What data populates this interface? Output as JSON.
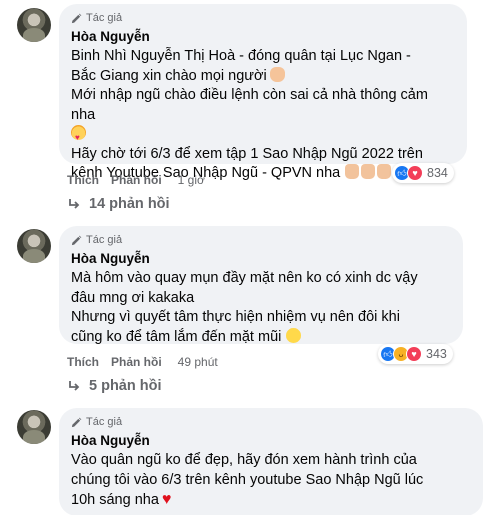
{
  "comments": [
    {
      "badge": "Tác giả",
      "author": "Hòa Nguyễn",
      "lines": [
        "Binh Nhì Nguyễn Thị Hoà - đóng quân tại Lục Ngan -",
        "Bắc Giang xin chào mọi người",
        "Mới nhập ngũ chào điều lệnh còn sai cả nhà thông cảm",
        "nha",
        "Hãy chờ tới 6/3 để xem tập 1 Sao Nhập Ngũ 2022 trên",
        "kênh Youtube Sao Nhập Ngũ - QPVN nha"
      ],
      "like_label": "Thích",
      "reply_label": "Phản hồi",
      "time": "1 giờ",
      "reaction_count": "834",
      "replies_label": "14 phản hồi"
    },
    {
      "badge": "Tác giả",
      "author": "Hòa Nguyễn",
      "lines": [
        "Mà hôm vào quay mụn đầy mặt nên ko có xinh dc vậy",
        "đâu mng ơi kakaka",
        "Nhưng vì quyết tâm thực hiện nhiệm vụ nên đôi khi",
        "cũng ko để tâm lắm đến mặt mũi"
      ],
      "like_label": "Thích",
      "reply_label": "Phản hồi",
      "time": "49 phút",
      "reaction_count": "343",
      "replies_label": "5 phản hồi"
    },
    {
      "badge": "Tác giả",
      "author": "Hòa Nguyễn",
      "lines": [
        "Vào quân ngũ ko để đẹp, hãy đón xem hành trình của",
        "chúng tôi vào 6/3 trên kênh youtube Sao Nhập Ngũ lúc",
        "10h sáng nha"
      ]
    }
  ],
  "icons": {
    "author_badge": "pencil-icon",
    "replies": "reply-arrow-icon",
    "reactions_1": [
      "like-icon",
      "love-icon"
    ],
    "reactions_2": [
      "like-icon",
      "haha-icon",
      "love-icon"
    ]
  },
  "colors": {
    "bubble": "#f0f2f5",
    "secondary_text": "#65676b",
    "like_blue": "#1877f2",
    "love_red": "#f33e58"
  }
}
